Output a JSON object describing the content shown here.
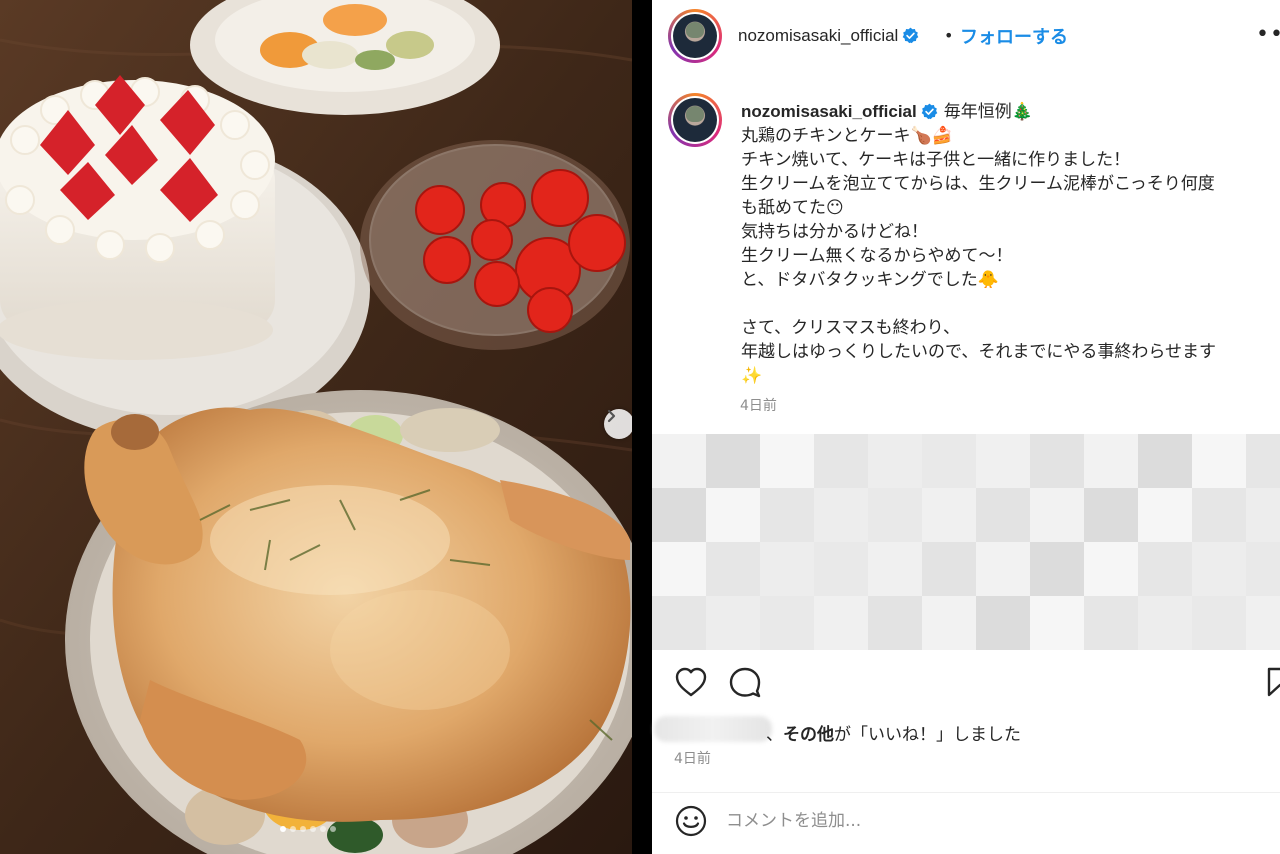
{
  "post": {
    "username": "nozomisasaki_official",
    "header_separator": "•",
    "follow_label": "フォローする",
    "more_label": "•••",
    "caption_title": "毎年恒例",
    "caption_title_emoji": "🎄",
    "caption_lines": [
      "丸鶏のチキンとケーキ🍗🍰",
      "チキン焼いて、ケーキは子供と一緒に作りました！",
      "生クリームを泡立ててからは、生クリーム泥棒がこっそり何度",
      "も舐めてた😶",
      "気持ちは分かるけどね！",
      "生クリーム無くなるからやめて〜！",
      "と、ドタバタクッキングでした🐥",
      "",
      "さて、クリスマスも終わり、",
      "年越しはゆっくりしたいので、それまでにやる事終わらせます",
      "✨"
    ],
    "caption_time": "4日前",
    "likes_separator": "、",
    "likes_others": "その他",
    "likes_suffix": "が「いいね！」しました",
    "post_time": "4日前",
    "comment_placeholder": "コメントを追加..."
  },
  "carousel": {
    "total": 6,
    "active_index": 0
  }
}
